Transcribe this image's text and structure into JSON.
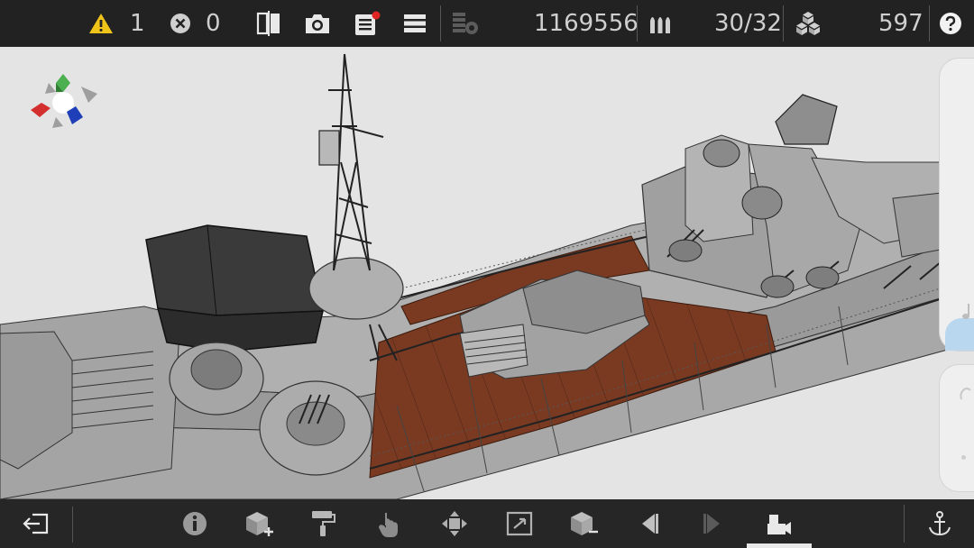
{
  "status": {
    "warnings": "1",
    "errors": "0",
    "points": "1169556",
    "ammo": "30/32",
    "parts": "597"
  },
  "icons": {
    "warning": "warning-triangle-icon",
    "error": "error-circle-icon",
    "mirror": "mirror-split-icon",
    "camera": "camera-icon",
    "checklist": "checklist-notification-icon",
    "menu": "menu-lines-icon",
    "coins": "coins-icon",
    "ammo": "ammo-shells-icon",
    "parts": "parts-stack-icon",
    "help": "help-icon",
    "exit": "exit-icon",
    "info": "info-icon",
    "add_part": "add-part-icon",
    "paint": "paint-roller-icon",
    "touch": "touch-select-icon",
    "move": "move-arrows-icon",
    "rotate": "rotate-frame-icon",
    "remove_part": "remove-part-icon",
    "prev": "previous-icon",
    "next": "next-icon",
    "camera_mode": "camera-mode-icon",
    "anchor": "anchor-icon"
  },
  "colors": {
    "deck_wood": "#7a3a22",
    "hull_gray": "#9a9a9a",
    "bar_bg": "#222222",
    "warning_yellow": "#f0c419",
    "notification_red": "#e02424"
  }
}
